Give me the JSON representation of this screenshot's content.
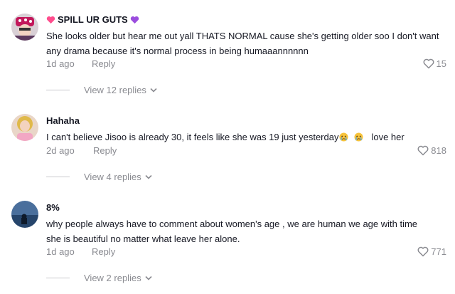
{
  "comments": [
    {
      "username": "SPILL UR GUTS",
      "text": "She looks older but hear me out yall THATS NORMAL cause she's getting older soo I don't want any drama because it's normal process in being humaaannnnnn",
      "date": "1d ago",
      "reply_label": "Reply",
      "likes": "15",
      "view_replies": "View 12 replies",
      "avatar_icon": "cartoon-avatar"
    },
    {
      "username": "Hahaha",
      "text_before": "I can't believe Jisoo is already 30, it feels like she was 19 just yesterday",
      "text_after": "love her",
      "emoji_icon": "crying-face",
      "date": "2d ago",
      "reply_label": "Reply",
      "likes": "818",
      "view_replies": "View 4 replies",
      "avatar_icon": "photo-avatar"
    },
    {
      "username": "8%",
      "text": "why people always have to comment about women's age , we are human we age with time she is beautiful no matter what leave her alone.",
      "date": "1d ago",
      "reply_label": "Reply",
      "likes": "771",
      "view_replies": "View 2 replies",
      "avatar_icon": "sea-avatar"
    }
  ],
  "colors": {
    "text": "#161823",
    "meta": "#8a8b91",
    "heart_pink": "#ff4d8d",
    "heart_purple": "#9b4dde"
  }
}
